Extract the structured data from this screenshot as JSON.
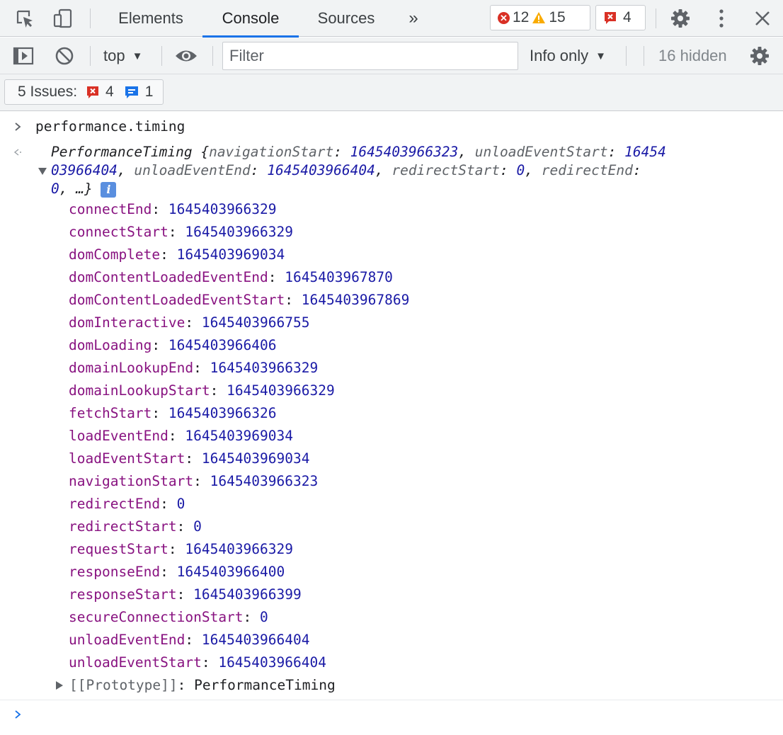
{
  "tabs": {
    "elements": "Elements",
    "console": "Console",
    "sources": "Sources",
    "more": "»"
  },
  "counters": {
    "errors": "12",
    "warnings": "15",
    "issues": "4"
  },
  "toolbar": {
    "context": "top",
    "filter_placeholder": "Filter",
    "level": "Info only",
    "hidden": "16 hidden"
  },
  "issues_bar": {
    "label": "5 Issues:",
    "errors": "4",
    "info": "1"
  },
  "console": {
    "command": "performance.timing",
    "summary": {
      "type": "PerformanceTiming",
      "line1_props": [
        {
          "k": "navigationStart",
          "v": "1645403966323"
        },
        {
          "k": "unloadEventStart",
          "v": "16454"
        }
      ],
      "line2_cont": "03966404",
      "line2_props": [
        {
          "k": "unloadEventEnd",
          "v": "1645403966404"
        },
        {
          "k": "redirectStart",
          "v": "0"
        },
        {
          "k": "redirectEnd",
          "v": ""
        }
      ],
      "line3_val": "0",
      "line3_tail": ", …}",
      "info_glyph": "i"
    },
    "properties": [
      {
        "key": "connectEnd",
        "value": "1645403966329"
      },
      {
        "key": "connectStart",
        "value": "1645403966329"
      },
      {
        "key": "domComplete",
        "value": "1645403969034"
      },
      {
        "key": "domContentLoadedEventEnd",
        "value": "1645403967870"
      },
      {
        "key": "domContentLoadedEventStart",
        "value": "1645403967869"
      },
      {
        "key": "domInteractive",
        "value": "1645403966755"
      },
      {
        "key": "domLoading",
        "value": "1645403966406"
      },
      {
        "key": "domainLookupEnd",
        "value": "1645403966329"
      },
      {
        "key": "domainLookupStart",
        "value": "1645403966329"
      },
      {
        "key": "fetchStart",
        "value": "1645403966326"
      },
      {
        "key": "loadEventEnd",
        "value": "1645403969034"
      },
      {
        "key": "loadEventStart",
        "value": "1645403969034"
      },
      {
        "key": "navigationStart",
        "value": "1645403966323"
      },
      {
        "key": "redirectEnd",
        "value": "0"
      },
      {
        "key": "redirectStart",
        "value": "0"
      },
      {
        "key": "requestStart",
        "value": "1645403966329"
      },
      {
        "key": "responseEnd",
        "value": "1645403966400"
      },
      {
        "key": "responseStart",
        "value": "1645403966399"
      },
      {
        "key": "secureConnectionStart",
        "value": "0"
      },
      {
        "key": "unloadEventEnd",
        "value": "1645403966404"
      },
      {
        "key": "unloadEventStart",
        "value": "1645403966404"
      }
    ],
    "prototype_key": "[[Prototype]]",
    "prototype_value": "PerformanceTiming"
  },
  "colors": {
    "key": "#881280",
    "number": "#1a1aa6",
    "accent": "#1a73e8",
    "error": "#d93025",
    "warning": "#f9ab00"
  }
}
